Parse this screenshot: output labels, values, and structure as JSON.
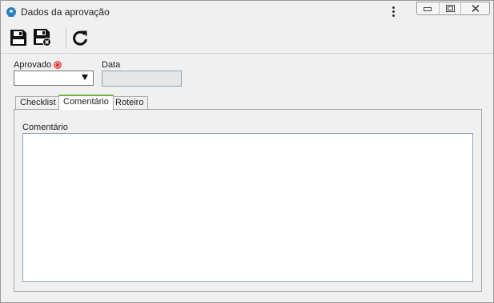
{
  "window": {
    "title": "Dados da aprovação",
    "icons": {
      "app": "app-icon",
      "menu": "kebab-menu-icon",
      "minimize": "minimize-icon",
      "restore": "restore-icon",
      "close": "close-icon"
    }
  },
  "toolbar": {
    "buttons": [
      {
        "name": "save",
        "icon": "save-icon"
      },
      {
        "name": "save-and-close",
        "icon": "save-close-icon"
      },
      {
        "name": "refresh",
        "icon": "refresh-icon"
      }
    ]
  },
  "form": {
    "approved": {
      "label": "Aprovado",
      "value": "",
      "required_icon": "required-icon"
    },
    "date": {
      "label": "Data",
      "value": ""
    }
  },
  "tabs": [
    {
      "label": "Checklist",
      "active": false
    },
    {
      "label": "Comentário",
      "active": true
    },
    {
      "label": "Roteiro",
      "active": false
    }
  ],
  "comment": {
    "label": "Comentário",
    "value": ""
  },
  "colors": {
    "accent_tab": "#70b33b",
    "required": "#e02020",
    "field_border": "#8fa5c0"
  }
}
